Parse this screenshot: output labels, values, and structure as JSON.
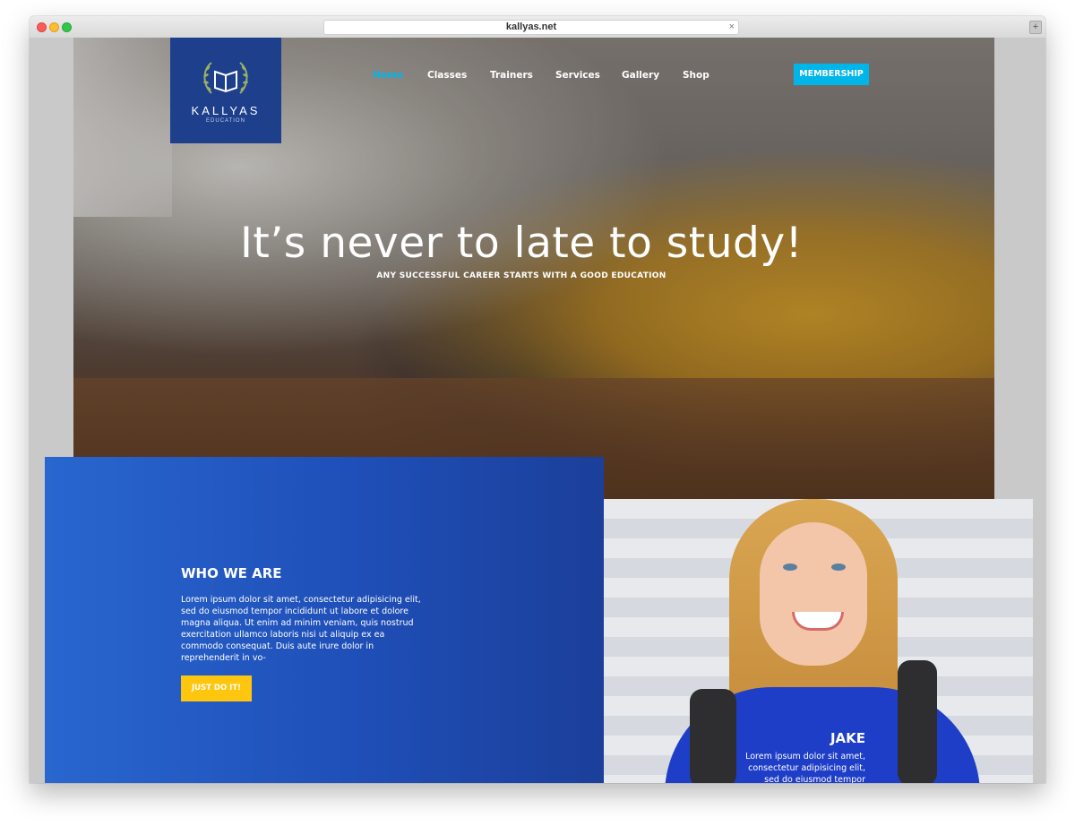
{
  "browser": {
    "url": "kallyas.net",
    "close_glyph": "×",
    "newtab_glyph": "+"
  },
  "logo": {
    "name": "KALLYAS",
    "subtitle": "EDUCATION",
    "icon": "book-wreath-icon"
  },
  "nav": {
    "items": [
      {
        "label": "Home",
        "active": true
      },
      {
        "label": "Classes",
        "active": false
      },
      {
        "label": "Trainers",
        "active": false
      },
      {
        "label": "Services",
        "active": false
      },
      {
        "label": "Gallery",
        "active": false
      },
      {
        "label": "Shop",
        "active": false
      }
    ],
    "cta": "MEMBERSHIP"
  },
  "hero": {
    "title": "It’s never to late to study!",
    "subtitle": "ANY SUCCESSFUL CAREER STARTS WITH A GOOD EDUCATION"
  },
  "about": {
    "title": "WHO WE ARE",
    "text": "Lorem ipsum dolor sit amet, consectetur adipisicing elit, sed do eiusmod tempor incididunt ut labore et dolore magna aliqua. Ut enim ad minim veniam, quis nostrud exercitation ullamco laboris nisi ut aliquip ex ea commodo consequat. Duis aute irure dolor in reprehenderit in vo-",
    "button": "JUST DO IT!"
  },
  "testimonial": {
    "name": "JAKE",
    "text": "Lorem ipsum dolor sit amet, consectetur adipisicing elit, sed do eiusmod tempor incididunt"
  },
  "colors": {
    "accent": "#00b6e8",
    "logo_bg": "#1d3f8c",
    "panel_blue": "#2457c4",
    "button_yellow": "#fec60e"
  }
}
